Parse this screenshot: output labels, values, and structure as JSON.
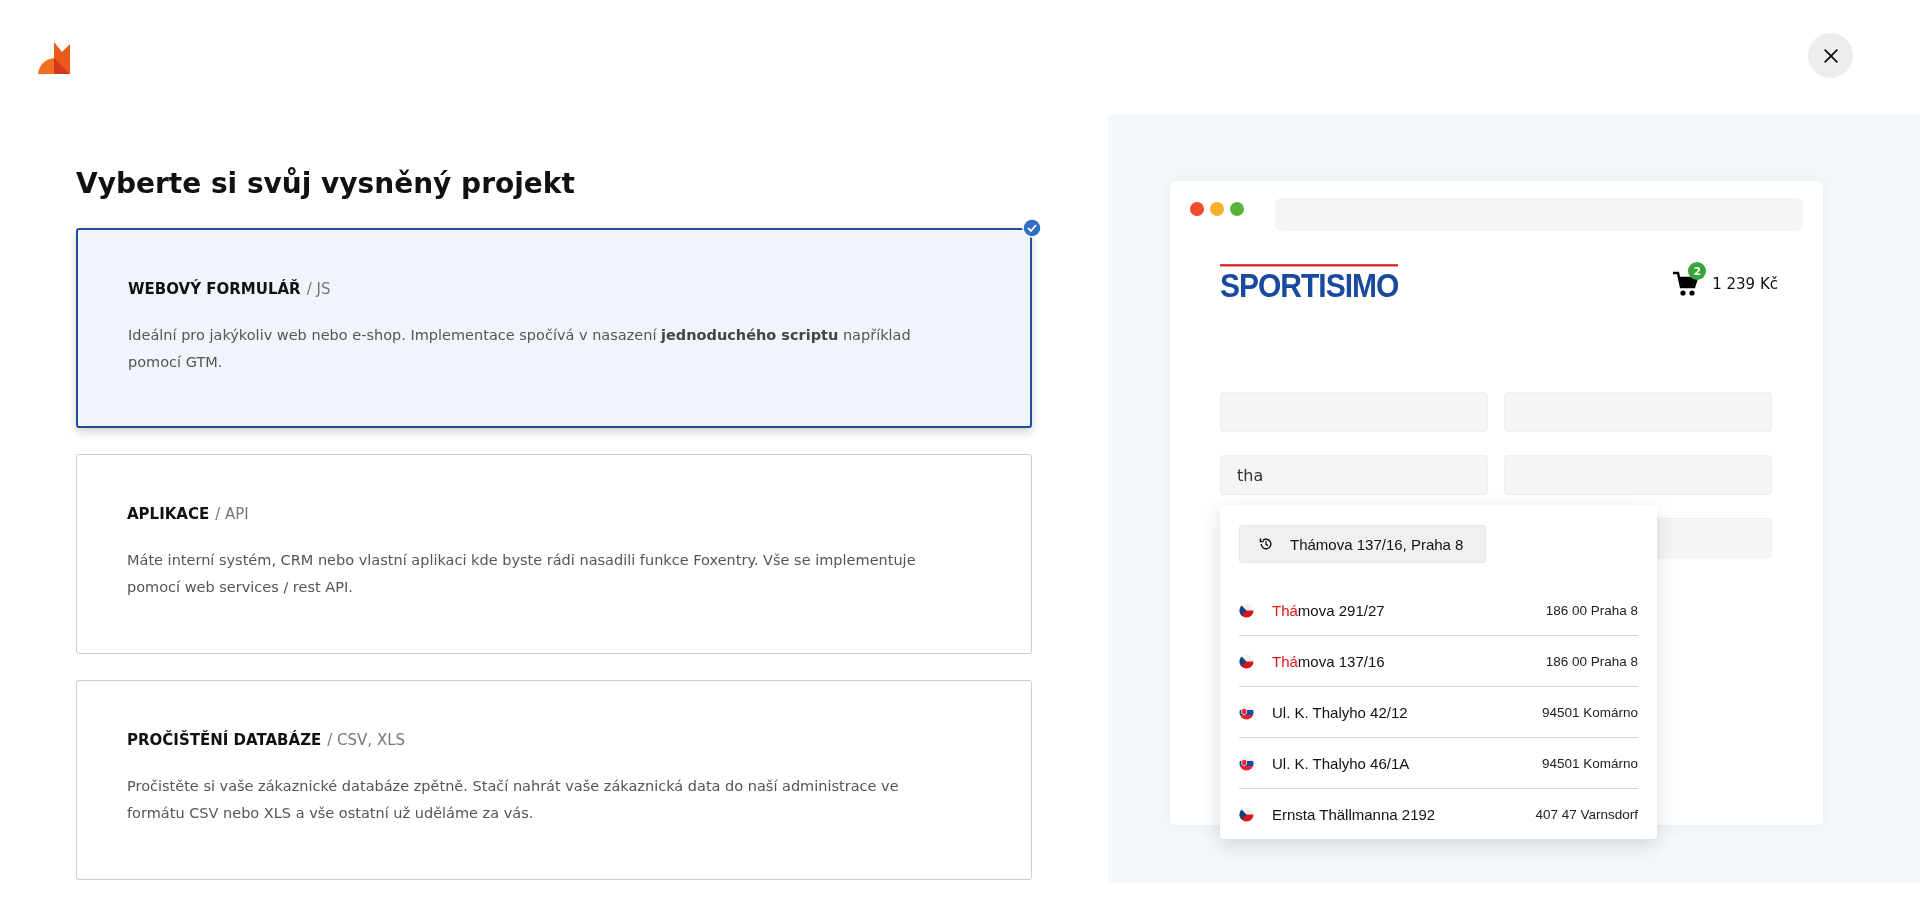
{
  "heading": "Vyberte si svůj vysněný projekt",
  "options": [
    {
      "title": "WEBOVÝ FORMULÁŘ",
      "subtitle": "/ JS",
      "description": "Ideální pro jakýkoliv web nebo e-shop. Implementace spočívá v nasazení **jednoduchého scriptu** například pomocí GTM.",
      "selected": true
    },
    {
      "title": "APLIKACE",
      "subtitle": "/ API",
      "description": "Máte interní systém, CRM nebo vlastní aplikaci kde byste rádi nasadili funkce Foxentry. Vše se implementuje pomocí web services / rest API.",
      "selected": false
    },
    {
      "title": "PROČIŠTĚNÍ DATABÁZE",
      "subtitle": "/ CSV, XLS",
      "description": "Pročistěte si vaše zákaznické databáze zpětně. Stačí nahrát vaše zákaznická data do naší administrace ve formátu CSV nebo XLS a vše ostatní už uděláme za vás.",
      "selected": false
    }
  ],
  "preview": {
    "shop_logo": "SPORTISIMO",
    "cart_count": "2",
    "cart_total": "1 239 Kč",
    "typed_value": "tha",
    "history": "Thámova 137/16, Praha 8",
    "suggestions": [
      {
        "kind": "cz",
        "match": "Thá",
        "street": "mova 291/27",
        "city": "186 00 Praha 8"
      },
      {
        "kind": "cz",
        "match": "Thá",
        "street": "mova 137/16",
        "city": "186 00 Praha 8"
      },
      {
        "kind": "sk",
        "street": "Ul. K. Thalyho 42/12",
        "city": "94501 Komárno"
      },
      {
        "kind": "sk",
        "street": "Ul. K. Thalyho 46/1A",
        "city": "94501 Komárno"
      },
      {
        "kind": "cz",
        "street": "Ernsta Thällmanna 2192",
        "city": "407 47 Varnsdorf"
      }
    ]
  }
}
